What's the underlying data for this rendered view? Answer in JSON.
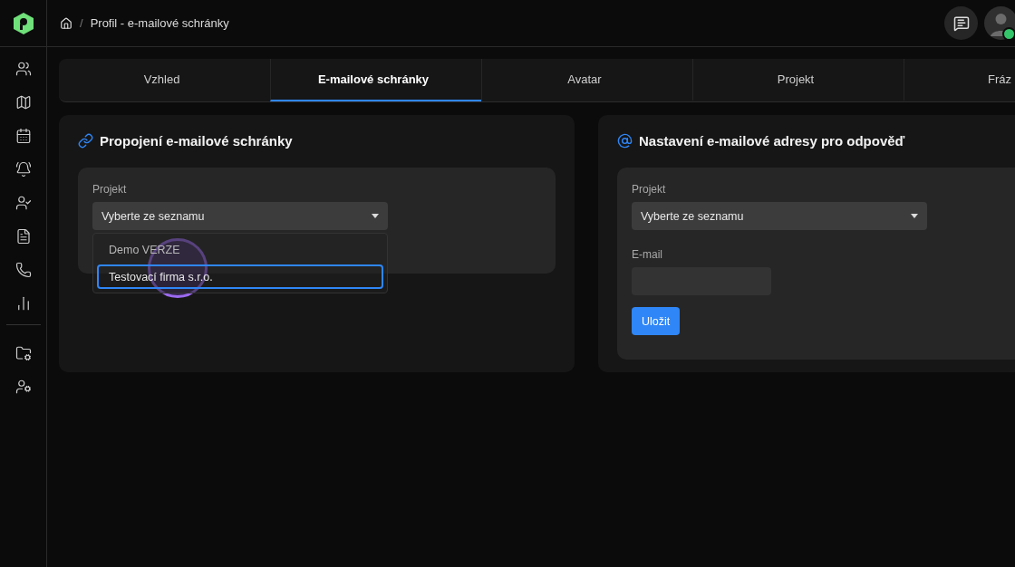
{
  "breadcrumb": {
    "separator": "/",
    "current": "Profil - e-mailové schránky"
  },
  "user": {
    "online": true
  },
  "tabs": [
    {
      "label": "Vzhled",
      "selected": false
    },
    {
      "label": "E-mailové schránky",
      "selected": true
    },
    {
      "label": "Avatar",
      "selected": false
    },
    {
      "label": "Projekt",
      "selected": false
    },
    {
      "label": "Fráz",
      "selected": false
    }
  ],
  "mailbox_link": {
    "title": "Propojení e-mailové schránky",
    "project_label": "Projekt",
    "project_value": "Vyberte ze seznamu",
    "options": [
      {
        "label": "Demo VERZE",
        "selected": false
      },
      {
        "label": "Testovací firma s.r.o.",
        "selected": true
      }
    ]
  },
  "reply_address": {
    "title": "Nastavení e-mailové adresy pro odpověď",
    "project_label": "Projekt",
    "project_value": "Vyberte ze seznamu",
    "email_label": "E-mail",
    "save_button": "Uložit"
  },
  "click_indicator": true
}
